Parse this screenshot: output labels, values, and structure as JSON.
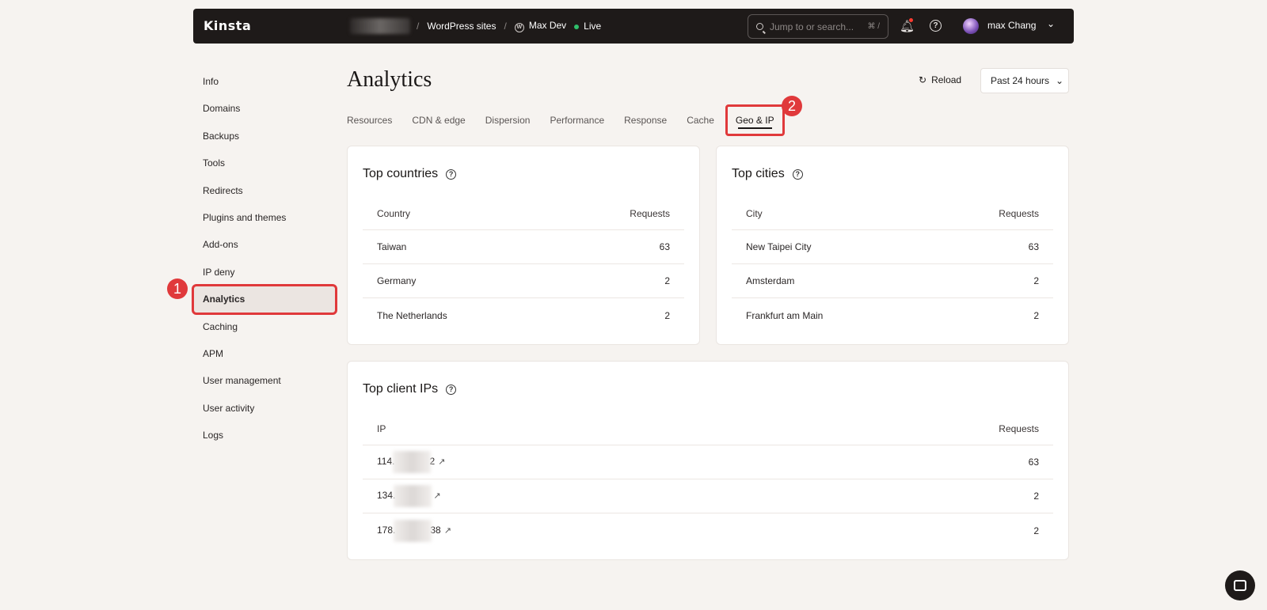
{
  "topbar": {
    "logo": "Kinsta",
    "breadcrumb": [
      "WordPress sites",
      "Max Dev",
      "Live"
    ],
    "search_placeholder": "Jump to or search...",
    "search_shortcut": "⌘ /",
    "user_name": "max Chang"
  },
  "sidebar": {
    "items": [
      "Info",
      "Domains",
      "Backups",
      "Tools",
      "Redirects",
      "Plugins and themes",
      "Add-ons",
      "IP deny",
      "Analytics",
      "Caching",
      "APM",
      "User management",
      "User activity",
      "Logs"
    ],
    "active": "Analytics"
  },
  "annotations": {
    "badge1": "1",
    "badge2": "2"
  },
  "main": {
    "title": "Analytics",
    "reload_label": "Reload",
    "range_label": "Past 24 hours",
    "tabs": [
      "Resources",
      "CDN & edge",
      "Dispersion",
      "Performance",
      "Response",
      "Cache",
      "Geo & IP"
    ],
    "active_tab": "Geo & IP"
  },
  "countries": {
    "title": "Top countries",
    "col1": "Country",
    "col2": "Requests",
    "rows": [
      {
        "name": "Taiwan",
        "value": "63"
      },
      {
        "name": "Germany",
        "value": "2"
      },
      {
        "name": "The Netherlands",
        "value": "2"
      }
    ]
  },
  "cities": {
    "title": "Top cities",
    "col1": "City",
    "col2": "Requests",
    "rows": [
      {
        "name": "New Taipei City",
        "value": "63"
      },
      {
        "name": "Amsterdam",
        "value": "2"
      },
      {
        "name": "Frankfurt am Main",
        "value": "2"
      }
    ]
  },
  "ips": {
    "title": "Top client IPs",
    "col1": "IP",
    "col2": "Requests",
    "rows": [
      {
        "prefix": "114.",
        "suffix": "2",
        "value": "63"
      },
      {
        "prefix": "134.",
        "suffix": "",
        "value": "2"
      },
      {
        "prefix": "178.",
        "suffix": "38",
        "value": "2"
      }
    ]
  }
}
